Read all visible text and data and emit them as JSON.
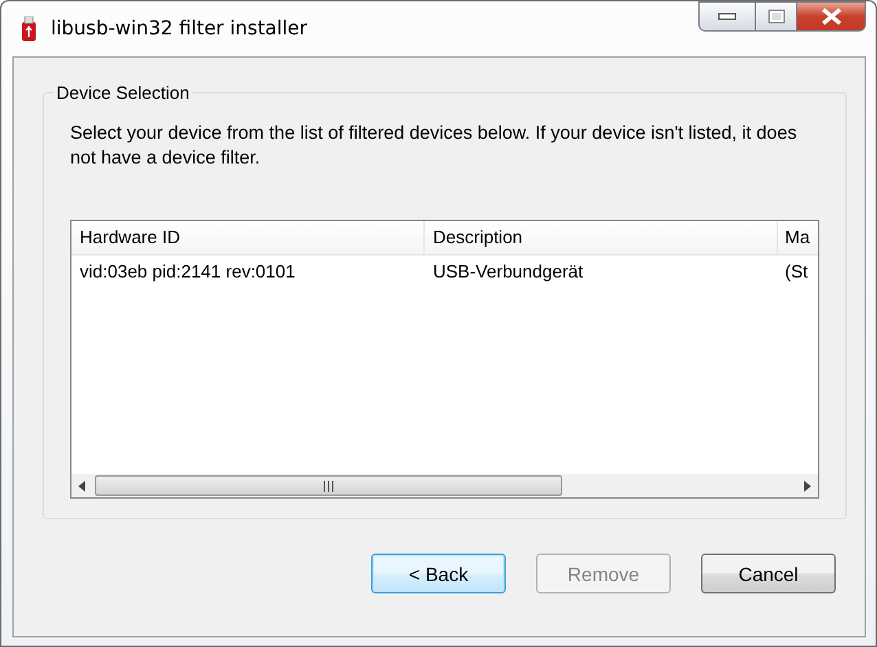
{
  "window": {
    "title": "libusb-win32 filter installer"
  },
  "group": {
    "title": "Device Selection",
    "text": "Select your device from the list of filtered devices below. If your device isn't listed, it does not have a device filter."
  },
  "table": {
    "columns": [
      "Hardware ID",
      "Description",
      "Ma"
    ],
    "rows": [
      [
        "vid:03eb pid:2141 rev:0101",
        "USB-Verbundgerät",
        "(St"
      ]
    ]
  },
  "buttons": [
    {
      "label": "< Back",
      "focused": true,
      "disabled": false
    },
    {
      "label": "Remove",
      "focused": false,
      "disabled": true
    },
    {
      "label": "Cancel",
      "focused": false,
      "disabled": false
    }
  ]
}
